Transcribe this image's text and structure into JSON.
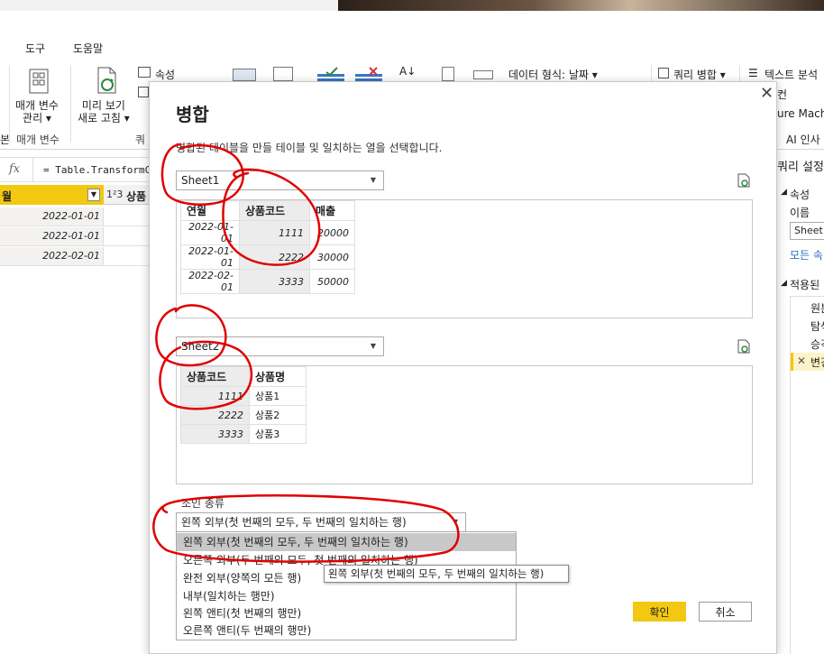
{
  "menubar": {
    "tools": "도구",
    "help": "도움말"
  },
  "ribbon": {
    "manage_params": "매개 변수",
    "manage_params2": "관리 ▾",
    "preview_refresh": "미리 보기",
    "preview_refresh2": "새로 고침 ▾",
    "properties": "속성",
    "params_group": "매개 변수",
    "query_group_cut": "쿼",
    "data_type": "데이터 형식: 날짜 ▾",
    "merge_queries": "쿼리 병합 ▾",
    "text_analysis": "텍스트 분석",
    "col_cut": "컨",
    "azure_ml": "ure Mach",
    "ai_insights": "AI 인사",
    "left_cut": "본"
  },
  "formula": {
    "fx": "fx",
    "text": "= Table.TransformC"
  },
  "grid": {
    "col1": "월",
    "col2_type": "1²3",
    "col2": "상품",
    "rows": [
      "2022-01-01",
      "2022-01-01",
      "2022-02-01"
    ]
  },
  "right_panel": {
    "query_settings": "쿼리 설정",
    "properties": "속성",
    "name": "이름",
    "name_value": "Sheet1",
    "all_props": "모든 속",
    "applied_steps": "적용된",
    "steps": [
      "원본",
      "탐색",
      "승격",
      "변경"
    ]
  },
  "dialog": {
    "title": "병합",
    "description": "병합된 테이블을 만들 테이블 및 일치하는 열을 선택합니다.",
    "table1": {
      "select": "Sheet1",
      "headers": [
        "연월",
        "상품코드",
        "매출"
      ],
      "rows": [
        [
          "2022-01-01",
          "1111",
          "20000"
        ],
        [
          "2022-01-01",
          "2222",
          "30000"
        ],
        [
          "2022-02-01",
          "3333",
          "50000"
        ]
      ]
    },
    "table2": {
      "select": "Sheet2",
      "headers": [
        "상품코드",
        "상품명"
      ],
      "rows": [
        [
          "1111",
          "상품1"
        ],
        [
          "2222",
          "상품2"
        ],
        [
          "3333",
          "상품3"
        ]
      ]
    },
    "join_label": "조인 종류",
    "join_selected": "왼쪽 외부(첫 번째의 모두, 두 번째의 일치하는 행)",
    "join_options": [
      "왼쪽 외부(첫 번째의 모두, 두 번째의 일치하는 행)",
      "오른쪽 외부(두 번째의 모두, 첫 번째의 일치하는 행)",
      "완전 외부(양쪽의 모든 행)",
      "내부(일치하는 행만)",
      "왼쪽 앤티(첫 번째의 행만)",
      "오른쪽 앤티(두 번째의 행만)"
    ],
    "tooltip": "왼쪽 외부(첫 번째의 모두, 두 번째의 일치하는 행)",
    "ok": "확인",
    "cancel": "취소"
  },
  "colors": {
    "accent": "#f2c811",
    "annotation": "#e00000"
  }
}
